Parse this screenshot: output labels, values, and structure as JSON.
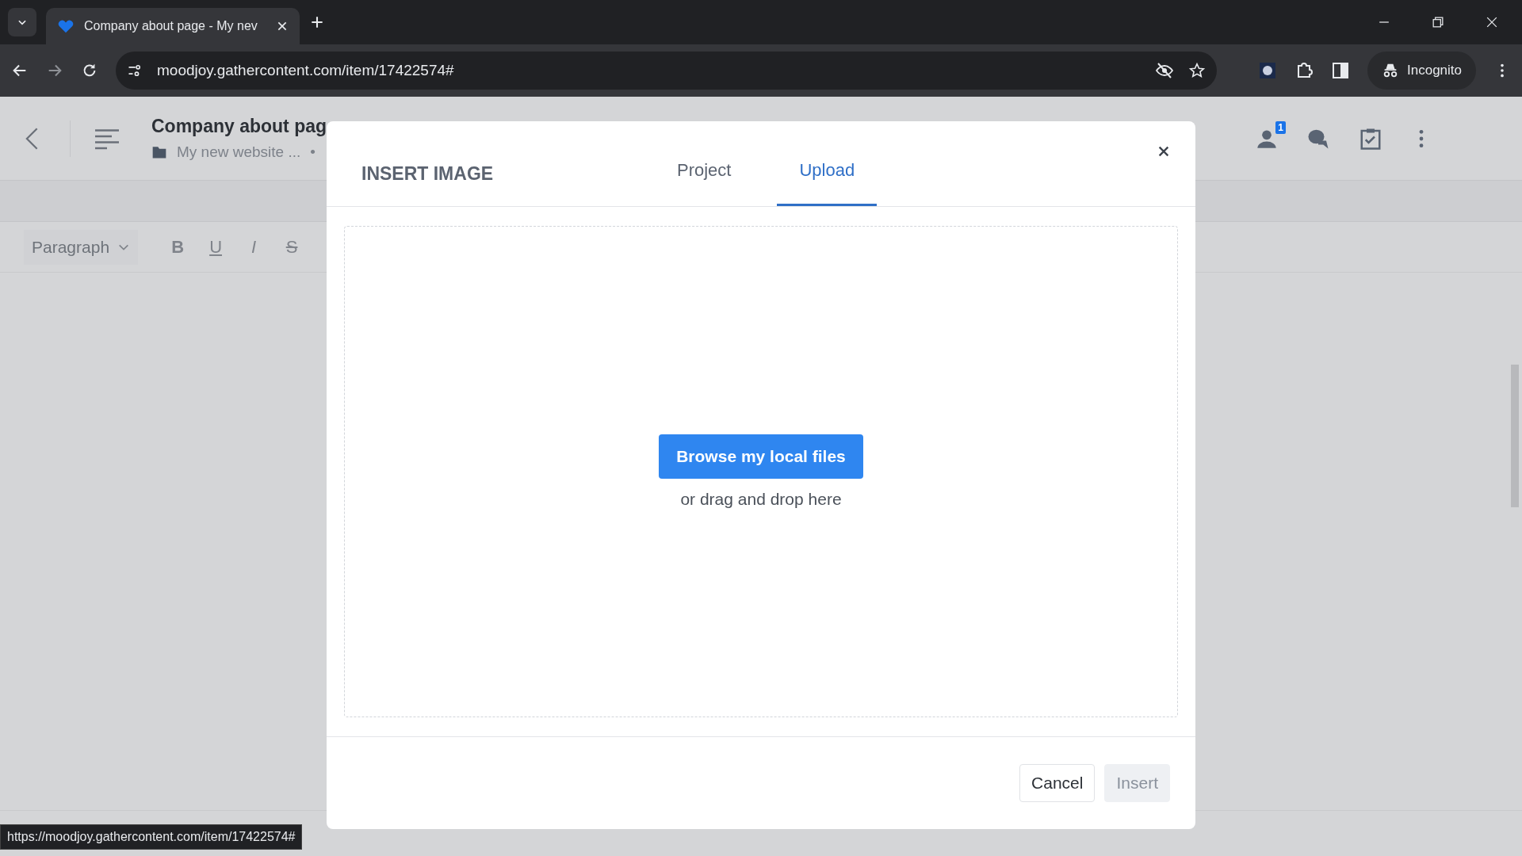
{
  "browser": {
    "tab_title": "Company about page - My nev",
    "url": "moodjoy.gathercontent.com/item/17422574#",
    "profile": "Incognito"
  },
  "app_header": {
    "title": "Company about pag",
    "breadcrumb": "My new website ...",
    "separator": "•",
    "notification_count": "1"
  },
  "editor_toolbar": {
    "style_dropdown": "Paragraph",
    "format_buttons": [
      {
        "label": "B",
        "kind": "bold"
      },
      {
        "label": "U",
        "kind": "underline"
      },
      {
        "label": "I",
        "kind": "italic"
      },
      {
        "label": "S",
        "kind": "strike"
      }
    ]
  },
  "dialog": {
    "title": "INSERT IMAGE",
    "tabs": [
      {
        "label": "Project",
        "selected": false
      },
      {
        "label": "Upload",
        "selected": true
      }
    ],
    "browse_button": "Browse my local files",
    "drop_hint": "or drag and drop here",
    "buttons": [
      {
        "label": "Cancel",
        "disabled": false
      },
      {
        "label": "Insert",
        "disabled": true
      }
    ]
  },
  "status_link": "https://moodjoy.gathercontent.com/item/17422574#"
}
